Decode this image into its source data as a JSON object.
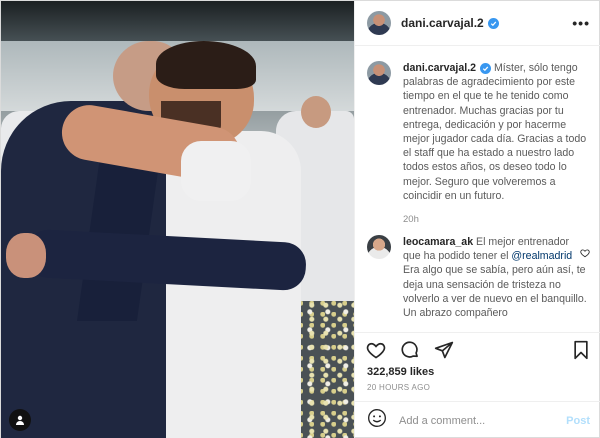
{
  "post": {
    "author": "dani.carvajal.2",
    "caption": "Míster, sólo tengo palabras de agradecimiento por este tiempo en el que te he tenido como entrenador. Muchas gracias por tu entrega, dedicación y por hacerme mejor jugador cada día. Gracias a todo el staff que ha estado a nuestro lado todos estos años, os deseo todo lo mejor. Seguro que volveremos a coincidir en un futuro.",
    "caption_time": "20h",
    "likes": "322,859 likes",
    "time_ago": "20 HOURS AGO"
  },
  "comment": {
    "username": "leocamara_ak",
    "text_before": "El mejor entrenador que ha podido tener el",
    "mention": "@realmadrid",
    "text_after": "Era algo que se sabía, pero aún así, te deja una sensación de tristeza no volverlo a ver de nuevo en el banquillo. Un abrazo compañero"
  },
  "add_comment": {
    "placeholder": "Add a comment...",
    "post_label": "Post"
  },
  "colors": {
    "verified": "#3897f0",
    "post_button": "#b2dffc",
    "mention": "#00376b"
  },
  "icons": [
    "more-options-icon",
    "verified-badge-icon",
    "heart-icon",
    "comment-icon",
    "share-icon",
    "bookmark-icon",
    "emoji-icon",
    "small-heart-icon"
  ]
}
